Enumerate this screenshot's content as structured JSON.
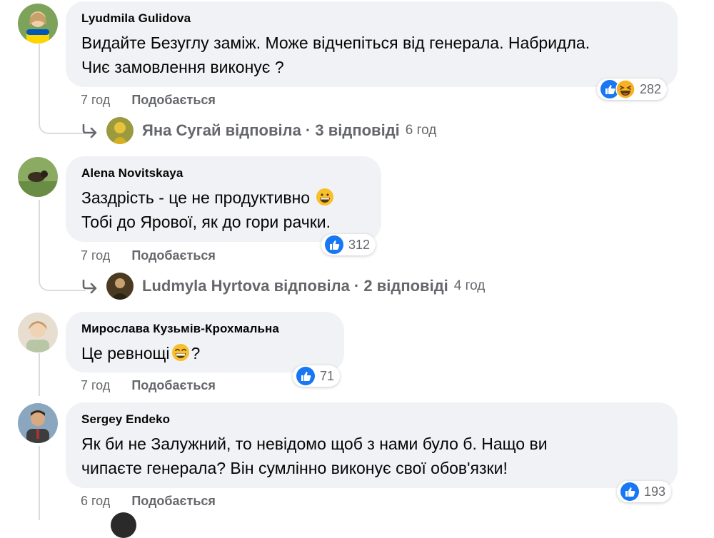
{
  "comments": [
    {
      "author": "Lyudmila Gulidova",
      "lines": [
        "Видайте Безуглу заміж. Може відчепіться від генерала. Набридла.",
        "Чиє замовлення виконує ?"
      ],
      "time": "7 год",
      "like_label": "Подобається",
      "reaction_count": "282",
      "reactions": [
        "like-icon",
        "haha-icon"
      ],
      "replies": {
        "name": "Яна Сугай",
        "verb": "відповіла",
        "count": "3 відповіді",
        "time": "6 год"
      }
    },
    {
      "author": "Alena Novitskaya",
      "lines": [
        "Заздрість - це не продуктивно",
        "Тобі до Ярової, як до гори рачки."
      ],
      "emoji_line1": "grinning-face-emoji",
      "time": "7 год",
      "like_label": "Подобається",
      "reaction_count": "312",
      "reactions": [
        "like-icon"
      ],
      "replies": {
        "name": "Ludmyla Hyrtova",
        "verb": "відповіла",
        "count": "2 відповіді",
        "time": "4 год"
      }
    },
    {
      "author": "Мирослава Кузьмів-Крохмальна",
      "lines": [
        "Це ревнощі",
        "?"
      ],
      "emoji_line1": "beaming-face-emoji",
      "time": "7 год",
      "like_label": "Подобається",
      "reaction_count": "71",
      "reactions": [
        "like-icon"
      ]
    },
    {
      "author": "Sergey Endeko",
      "lines": [
        "Як би не Залужний, то невідомо щоб з нами було б. Нащо ви",
        "чипаєте генерала? Він сумлінно виконує свої обов'язки!"
      ],
      "time": "6 год",
      "like_label": "Подобається",
      "reaction_count": "193",
      "reactions": [
        "like-icon"
      ]
    }
  ],
  "colors": {
    "bubble": "#f0f2f5",
    "meta_text": "#65676b",
    "like_blue": "#1877f2",
    "thread_line": "#d9dcdf"
  }
}
